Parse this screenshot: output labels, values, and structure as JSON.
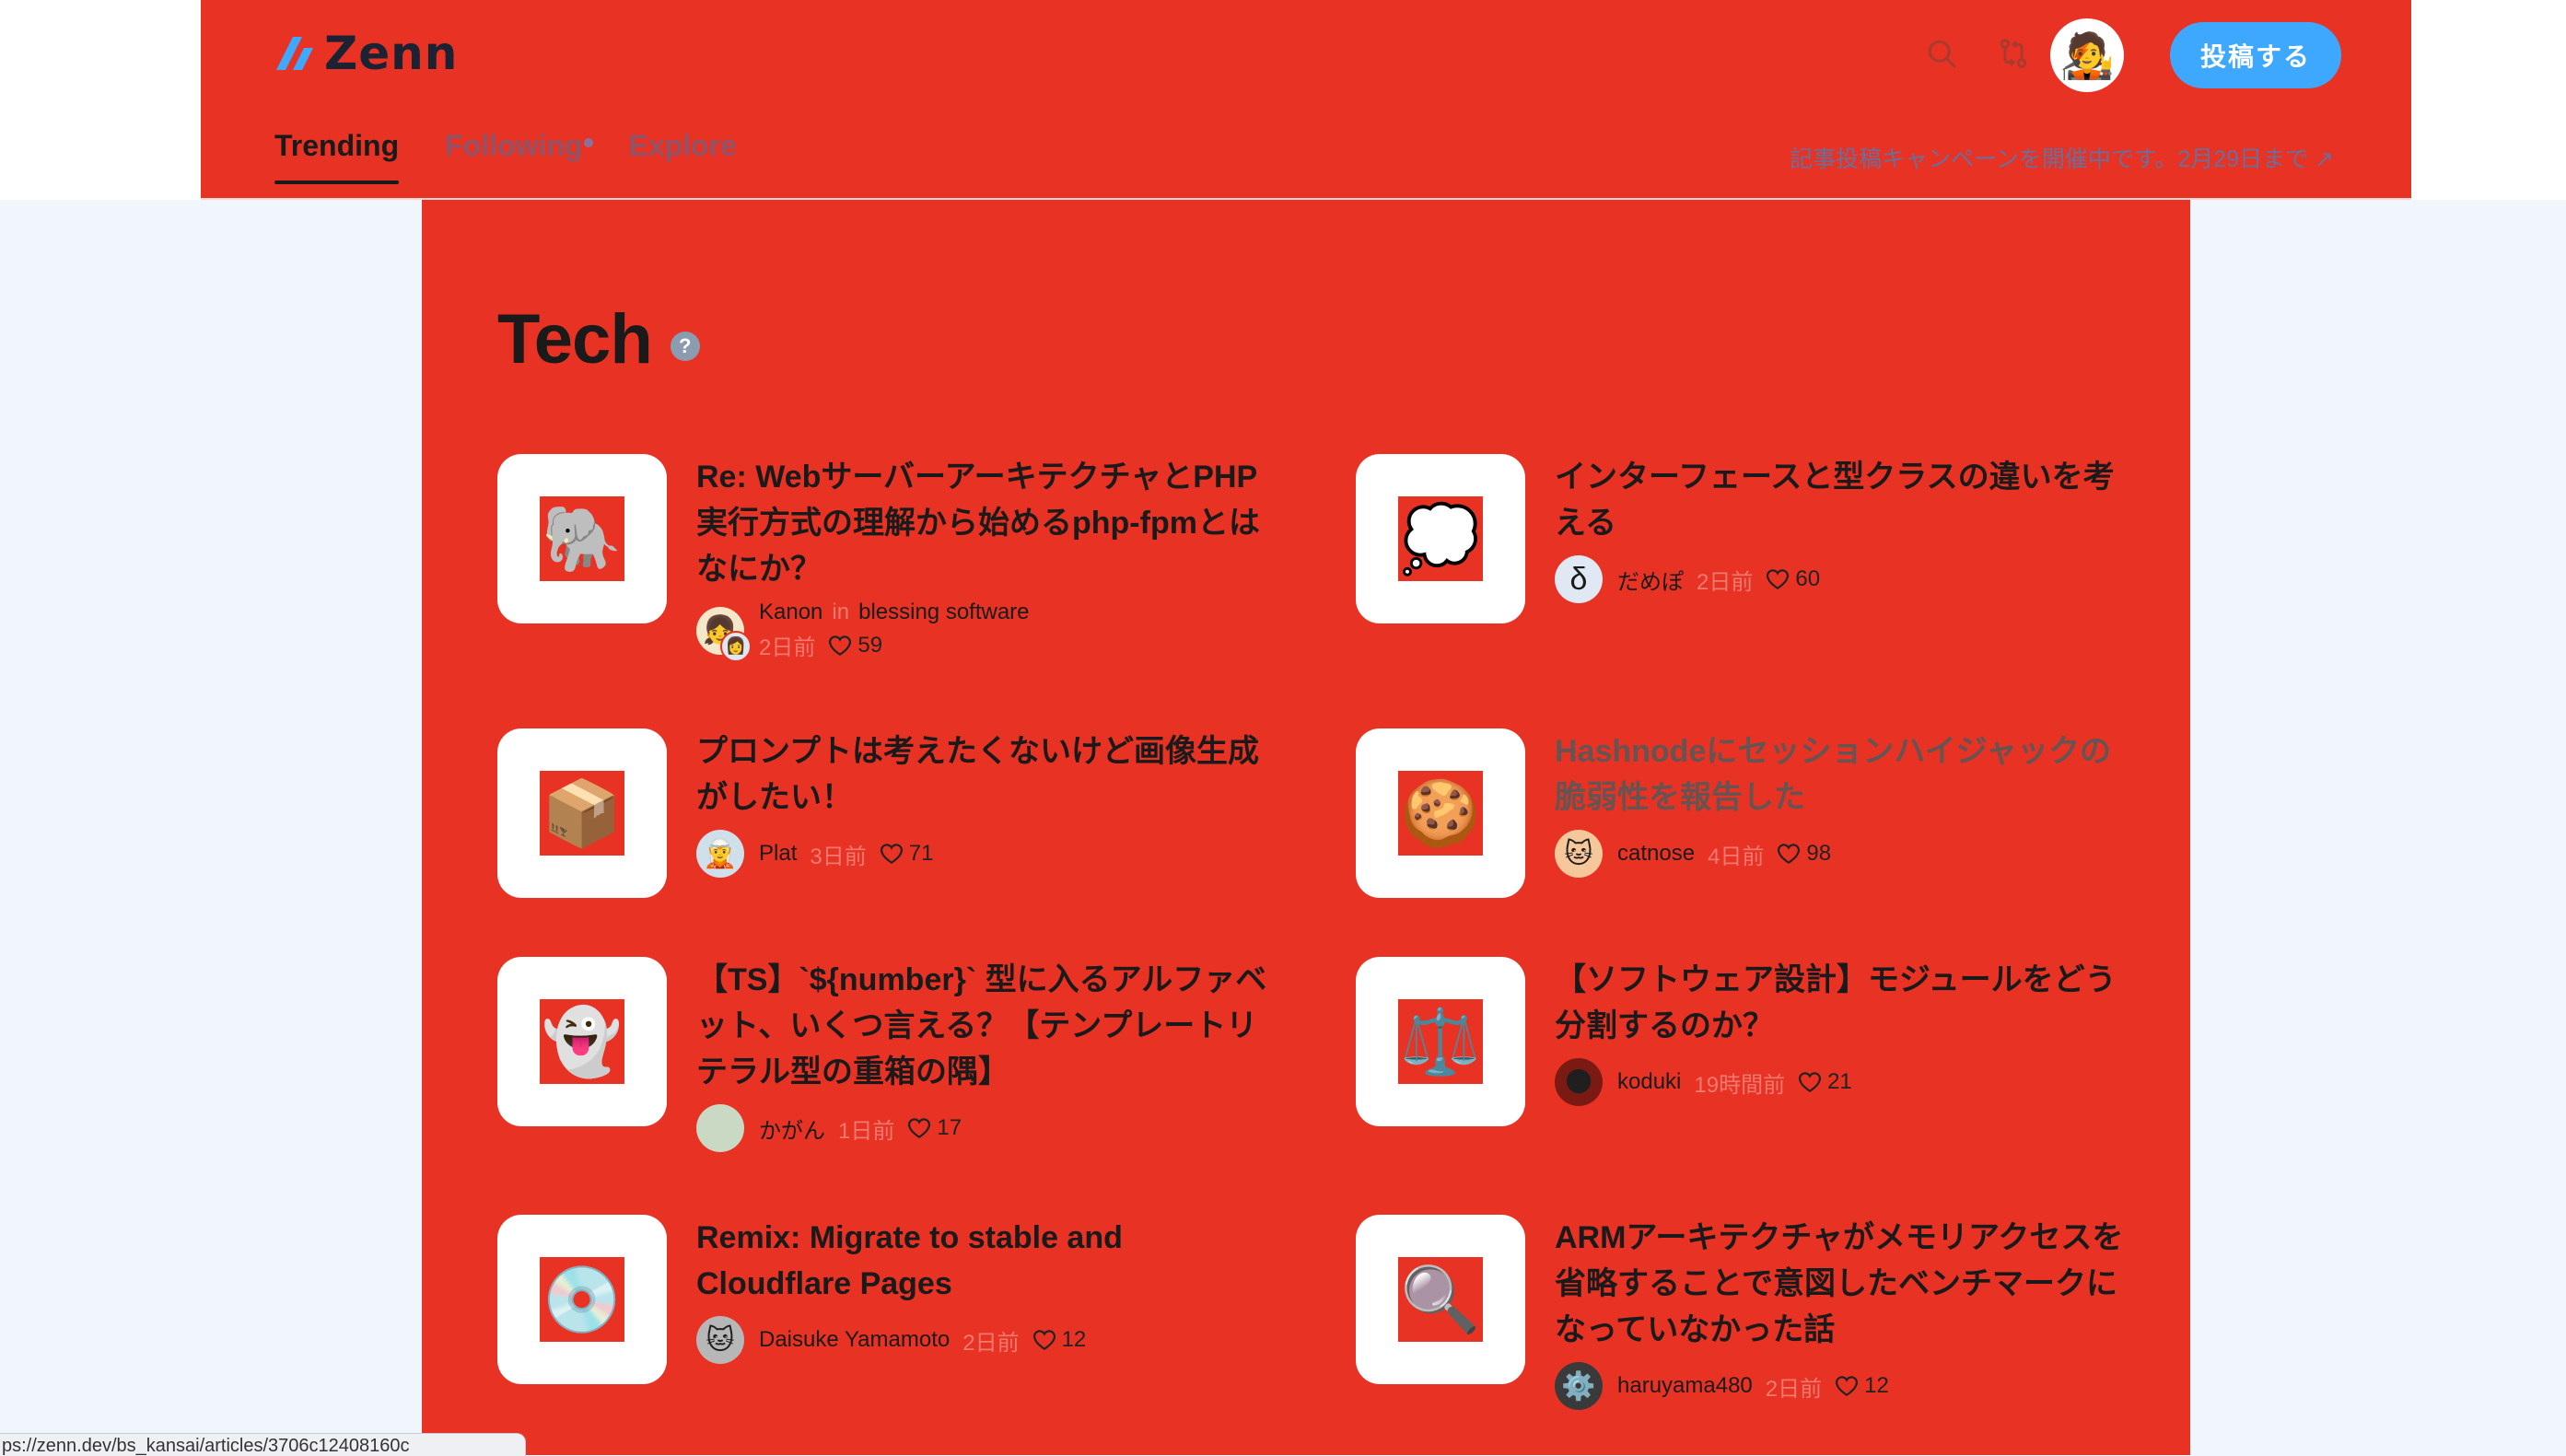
{
  "brand": {
    "name": "Zenn"
  },
  "header": {
    "post_button": "投稿する",
    "tabs": [
      {
        "label": "Trending"
      },
      {
        "label": "Following"
      },
      {
        "label": "Explore"
      }
    ],
    "campaign_link": "記事投稿キャンペーンを開催中です。2月29日まで ↗",
    "icons": [
      "search-icon",
      "git-compare-icon",
      "bell-icon"
    ],
    "colors": {
      "header_bg": "#e83224",
      "accent": "#3ea8ff"
    }
  },
  "section": {
    "title": "Tech",
    "help": "?"
  },
  "articles": [
    {
      "emoji": "🐘",
      "title": "Re: WebサーバーアーキテクチャとPHP実行方式の理解から始めるphp-fpmとはなにか？",
      "author": "Kanon",
      "in_text": "in",
      "publication": "blessing software",
      "time": "2日前",
      "likes": "59"
    },
    {
      "emoji": "💭",
      "title": "インターフェースと型クラスの違いを考える",
      "author": "だめぽ",
      "time": "2日前",
      "likes": "60"
    },
    {
      "emoji": "📦",
      "title": "プロンプトは考えたくないけど画像生成がしたい！",
      "author": "Plat",
      "time": "3日前",
      "likes": "71"
    },
    {
      "emoji": "🍪",
      "title": "Hashnodeにセッションハイジャックの脆弱性を報告した",
      "author": "catnose",
      "time": "4日前",
      "likes": "98"
    },
    {
      "emoji": "👻",
      "title": "【TS】`${number}` 型に入るアルファベット、いくつ言える？【テンプレートリテラル型の重箱の隅】",
      "author": "かがん",
      "time": "1日前",
      "likes": "17"
    },
    {
      "emoji": "⚖️",
      "title": "【ソフトウェア設計】モジュールをどう分割するのか？",
      "author": "koduki",
      "time": "19時間前",
      "likes": "21"
    },
    {
      "emoji": "💿",
      "title": "Remix: Migrate to stable and Cloudflare Pages",
      "author": "Daisuke Yamamoto",
      "time": "2日前",
      "likes": "12"
    },
    {
      "emoji": "🔍",
      "title": "ARMアーキテクチャがメモリアクセスを省略することで意図したベンチマークになっていなかった話",
      "author": "haruyama480",
      "time": "2日前",
      "likes": "12"
    }
  ],
  "status_url": "ps://zenn.dev/bs_kansai/articles/3706c12408160c"
}
